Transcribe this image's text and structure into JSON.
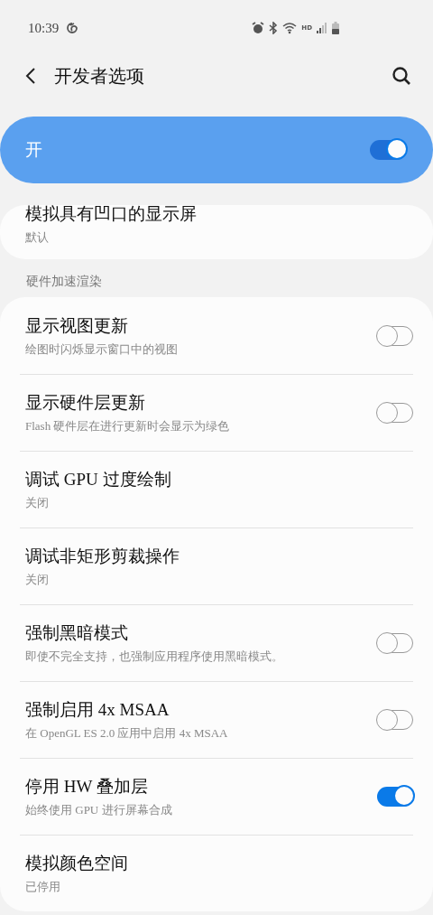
{
  "status_bar": {
    "time": "10:39",
    "network_label": "HD"
  },
  "header": {
    "title": "开发者选项"
  },
  "master_switch": {
    "label": "开",
    "on": true
  },
  "top_card": {
    "title": "模拟具有凹口的显示屏",
    "subtitle": "默认"
  },
  "section": {
    "title": "硬件加速渲染",
    "items": [
      {
        "kind": "switch",
        "title": "显示视图更新",
        "subtitle": "绘图时闪烁显示窗口中的视图",
        "on": false
      },
      {
        "kind": "switch",
        "title": "显示硬件层更新",
        "subtitle": "Flash 硬件层在进行更新时会显示为绿色",
        "on": false
      },
      {
        "kind": "plain",
        "title": "调试 GPU 过度绘制",
        "subtitle": "关闭"
      },
      {
        "kind": "plain",
        "title": "调试非矩形剪裁操作",
        "subtitle": "关闭"
      },
      {
        "kind": "switch",
        "title": "强制黑暗模式",
        "subtitle": "即使不完全支持，也强制应用程序使用黑暗模式。",
        "on": false
      },
      {
        "kind": "switch",
        "title": "强制启用 4x MSAA",
        "subtitle": "在 OpenGL ES 2.0 应用中启用 4x MSAA",
        "on": false
      },
      {
        "kind": "switch",
        "title": "停用 HW 叠加层",
        "subtitle": "始终使用 GPU 进行屏幕合成",
        "on": true
      },
      {
        "kind": "plain",
        "title": "模拟颜色空间",
        "subtitle": "已停用"
      }
    ]
  }
}
